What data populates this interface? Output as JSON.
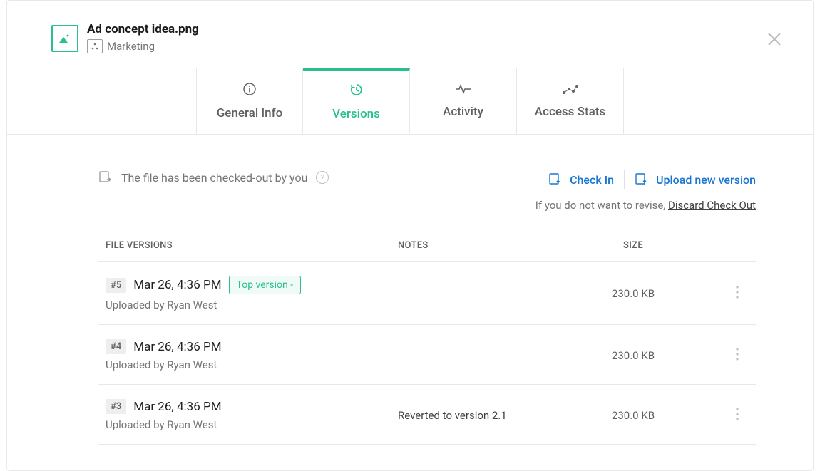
{
  "header": {
    "file_name": "Ad concept idea.png",
    "folder_name": "Marketing"
  },
  "tabs": [
    {
      "label": "General Info"
    },
    {
      "label": "Versions"
    },
    {
      "label": "Activity"
    },
    {
      "label": "Access Stats"
    }
  ],
  "status": {
    "message": "The file has been checked-out by you",
    "check_in_label": "Check In",
    "upload_label": "Upload new version",
    "discard_prefix": "If you do not want to revise, ",
    "discard_link": "Discard Check Out"
  },
  "table": {
    "headers": {
      "versions": "FILE VERSIONS",
      "notes": "NOTES",
      "size": "SIZE"
    },
    "rows": [
      {
        "num": "#5",
        "date": "Mar 26, 4:36 PM",
        "top_badge": "Top version -",
        "uploaded_by": "Uploaded by Ryan West",
        "notes": "",
        "size": "230.0 KB"
      },
      {
        "num": "#4",
        "date": "Mar 26, 4:36 PM",
        "top_badge": "",
        "uploaded_by": "Uploaded by Ryan West",
        "notes": "",
        "size": "230.0 KB"
      },
      {
        "num": "#3",
        "date": "Mar 26, 4:36 PM",
        "top_badge": "",
        "uploaded_by": "Uploaded by Ryan West",
        "notes": "Reverted to version 2.1",
        "size": "230.0 KB"
      }
    ]
  }
}
